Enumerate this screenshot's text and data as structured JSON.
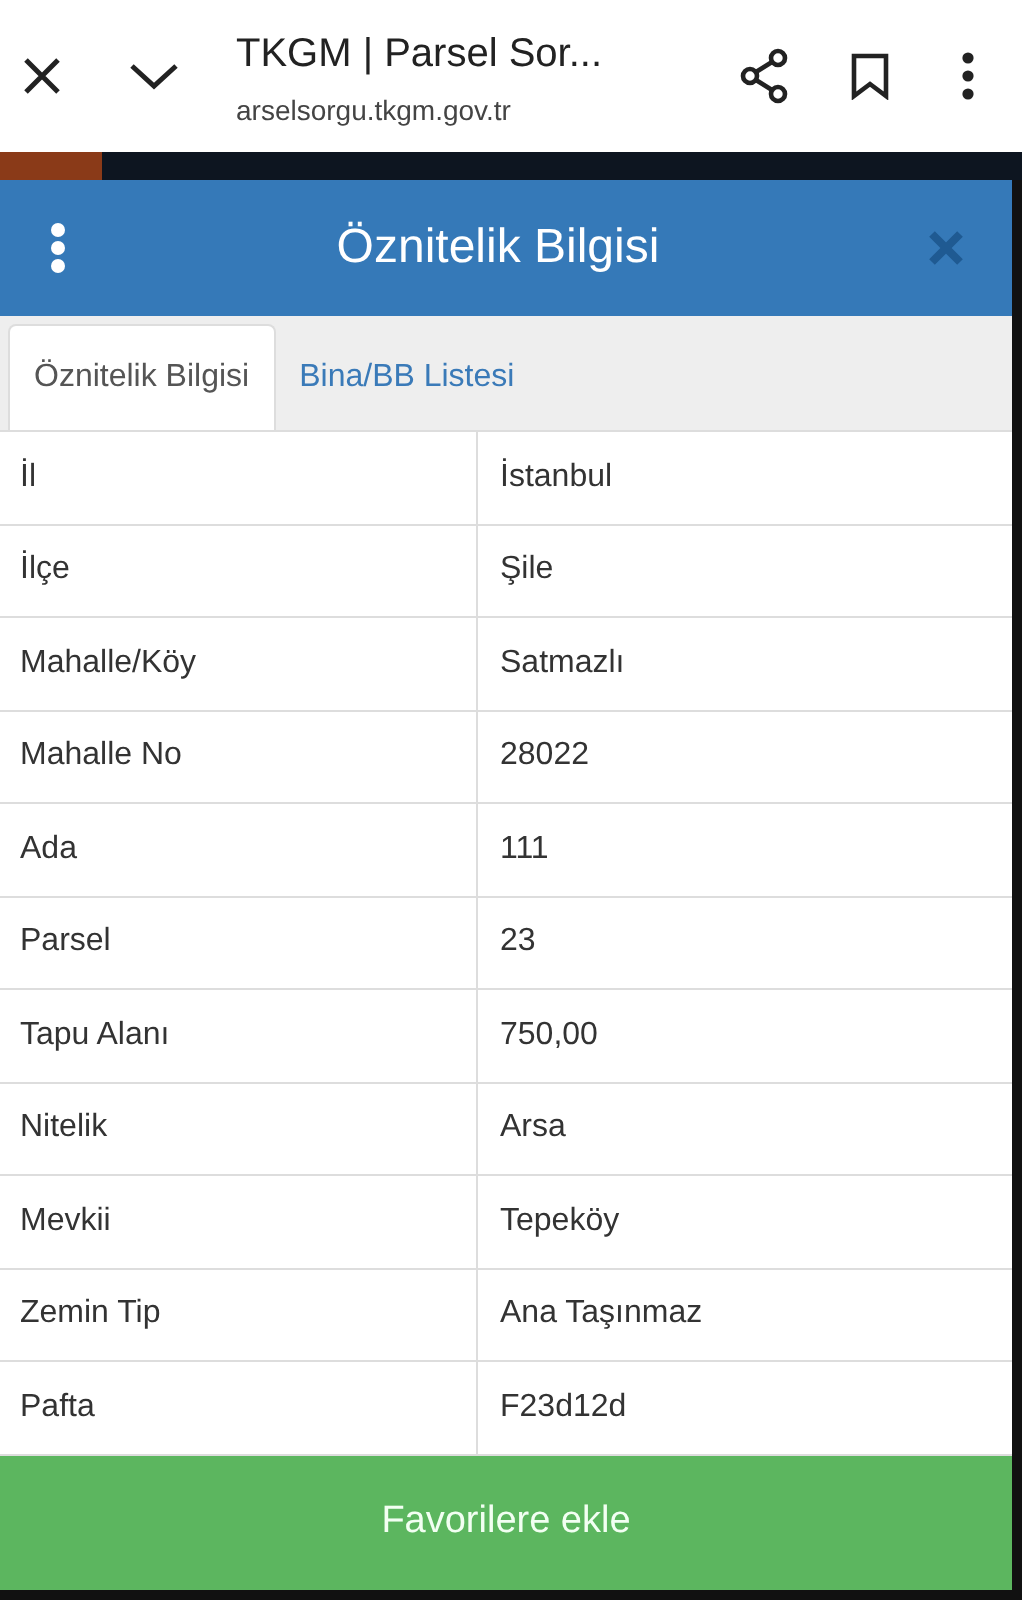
{
  "browser_bar": {
    "title": "TKGM | Parsel Sor...",
    "url": "arselsorgu.tkgm.gov.tr",
    "progress": {
      "level": 0.1
    }
  },
  "header": {
    "title": "Öznitelik Bilgisi"
  },
  "tabs": [
    {
      "label": "Öznitelik Bilgisi",
      "selected": true
    },
    {
      "label": "Bina/BB Listesi",
      "selected": false
    }
  ],
  "table": {
    "rows": [
      {
        "label": "İl",
        "value": "İstanbul"
      },
      {
        "label": "İlçe",
        "value": "Şile"
      },
      {
        "label": "Mahalle/Köy",
        "value": "Satmazlı"
      },
      {
        "label": "Mahalle No",
        "value": "28022"
      },
      {
        "label": "Ada",
        "value": "111"
      },
      {
        "label": "Parsel",
        "value": "23"
      },
      {
        "label": "Tapu Alanı",
        "value": "750,00"
      },
      {
        "label": "Nitelik",
        "value": "Arsa"
      },
      {
        "label": "Mevkii",
        "value": "Tepeköy"
      },
      {
        "label": "Zemin Tip",
        "value": "Ana Taşınmaz"
      },
      {
        "label": "Pafta",
        "value": "F23d12d"
      }
    ]
  },
  "button": {
    "label": "Favorilere ekle"
  }
}
